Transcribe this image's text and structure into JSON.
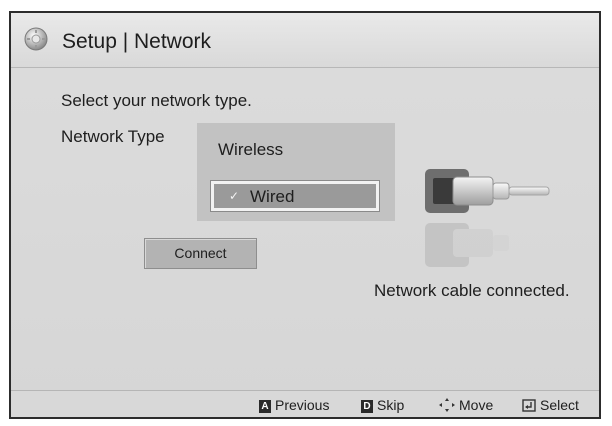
{
  "header": {
    "icon": "gear-icon",
    "title": "Setup | Network"
  },
  "main": {
    "prompt": "Select your network type.",
    "network_type_label": "Network Type",
    "options": [
      {
        "label": "Wireless",
        "selected": false
      },
      {
        "label": "Wired",
        "selected": true
      }
    ],
    "selected_mark": "✓",
    "connect_label": "Connect",
    "cable_icon": "network-cable-icon",
    "status": "Network cable connected."
  },
  "footer": {
    "hints": [
      {
        "key": "A",
        "label": "Previous"
      },
      {
        "key": "D",
        "label": "Skip"
      },
      {
        "key": "move-icon",
        "label": "Move"
      },
      {
        "key": "enter-icon",
        "label": "Select"
      }
    ]
  }
}
